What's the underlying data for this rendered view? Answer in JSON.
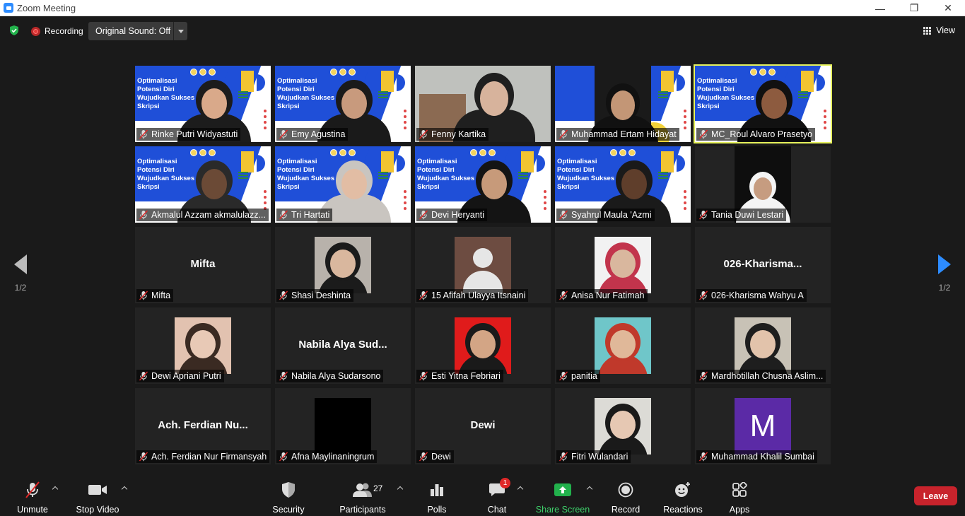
{
  "window": {
    "title": "Zoom Meeting",
    "minimize": "—",
    "restore": "❐",
    "close": "✕"
  },
  "topbar": {
    "recording": "Recording",
    "original_sound": "Original Sound: Off",
    "view": "View"
  },
  "nav": {
    "page_left": "1/2",
    "page_right": "1/2"
  },
  "slide": {
    "line1": "Optimalisasi",
    "line2": "Potensi Diri",
    "line3": "Wujudkan Sukses",
    "line4": "Skripsi",
    "url": "uny.org/"
  },
  "participants": [
    {
      "name": "Rinke Putri Widyastuti",
      "kind": "slide",
      "skin": "#d9a98a",
      "hair": "#1c1c1c"
    },
    {
      "name": "Emy Agustina",
      "kind": "slide",
      "skin": "#c89a7d",
      "hair": "#1a1a1a"
    },
    {
      "name": "Fenny Kartika",
      "kind": "room",
      "skin": "#d7b39c",
      "hair": "#1f1f1f"
    },
    {
      "name": "Muhammad Ertam Hidayat",
      "kind": "slide-dark",
      "skin": "#c39676",
      "hair": "#111111"
    },
    {
      "name": "MC_Roul Alvaro Prasetyo",
      "kind": "slide",
      "skin": "#8d5b3f",
      "hair": "#111111",
      "active": true
    },
    {
      "name": "Akmalul Azzam akmalulazz...",
      "kind": "slide",
      "skin": "#6b4a36",
      "hair": "#2a2a2a"
    },
    {
      "name": "Tri Hartati",
      "kind": "slide",
      "skin": "#e2bda4",
      "hair": "#c9c5c0"
    },
    {
      "name": "Devi Heryanti",
      "kind": "slide",
      "skin": "#c79a7a",
      "hair": "#141414"
    },
    {
      "name": "Syahrul Maula 'Azmi",
      "kind": "slide",
      "skin": "#5f3e2b",
      "hair": "#1a1a1a"
    },
    {
      "name": "Tania Duwi Lestari",
      "kind": "dark",
      "skin": "#c69c80",
      "hair": "#f4f4f4"
    },
    {
      "name": "Mifta",
      "kind": "name",
      "label": "Mifta"
    },
    {
      "name": "Shasi Deshinta",
      "kind": "photo",
      "bg": "#b8b2ab",
      "skin": "#d9b79e",
      "hair": "#1b1b1b"
    },
    {
      "name": "15 Afifah Ulayya Itsnaini",
      "kind": "avatar"
    },
    {
      "name": "Anisa Nur Fatimah",
      "kind": "photo",
      "bg": "#f2f2f2",
      "skin": "#d9b79e",
      "hair": "#c2344c"
    },
    {
      "name": "026-Kharisma Wahyu A",
      "kind": "name",
      "label": "026-Kharisma..."
    },
    {
      "name": "Dewi Apriani Putri",
      "kind": "photo",
      "bg": "#e2c2b0",
      "skin": "#e8c9b6",
      "hair": "#3a2a22"
    },
    {
      "name": "Nabila Alya Sudarsono",
      "kind": "name",
      "label": "Nabila Alya Sud..."
    },
    {
      "name": "Esti Yitna Febriari",
      "kind": "photo",
      "bg": "#e01b1b",
      "skin": "#d3a585",
      "hair": "#1a1a1a"
    },
    {
      "name": "panitia",
      "kind": "photo",
      "bg": "#6fc6c9",
      "skin": "#e0b899",
      "hair": "#c0392b"
    },
    {
      "name": "Mardhotillah Chusna Aslim...",
      "kind": "photo",
      "bg": "#c8c2b6",
      "skin": "#e2c3ab",
      "hair": "#1e1e1e"
    },
    {
      "name": "Ach. Ferdian Nur Firmansyah",
      "kind": "name",
      "label": "Ach. Ferdian Nu..."
    },
    {
      "name": "Afna Maylinaningrum",
      "kind": "black"
    },
    {
      "name": "Dewi",
      "kind": "name",
      "label": "Dewi"
    },
    {
      "name": "Fitri Wulandari",
      "kind": "photo",
      "bg": "#dcdbd6",
      "skin": "#e6c8b3",
      "hair": "#1a1a1a"
    },
    {
      "name": "Muhammad Khalil Sumbai",
      "kind": "letter",
      "letter": "M"
    }
  ],
  "toolbar": {
    "unmute": "Unmute",
    "stop_video": "Stop Video",
    "security": "Security",
    "participants": "Participants",
    "participants_count": "27",
    "polls": "Polls",
    "chat": "Chat",
    "chat_badge": "1",
    "share_screen": "Share Screen",
    "record": "Record",
    "reactions": "Reactions",
    "apps": "Apps",
    "leave": "Leave"
  },
  "colors": {
    "accent": "#2d8cff",
    "active_speaker": "#e6f25c",
    "leave": "#c8232c",
    "share": "#22b14c",
    "slide_blue": "#1f4fd8"
  }
}
